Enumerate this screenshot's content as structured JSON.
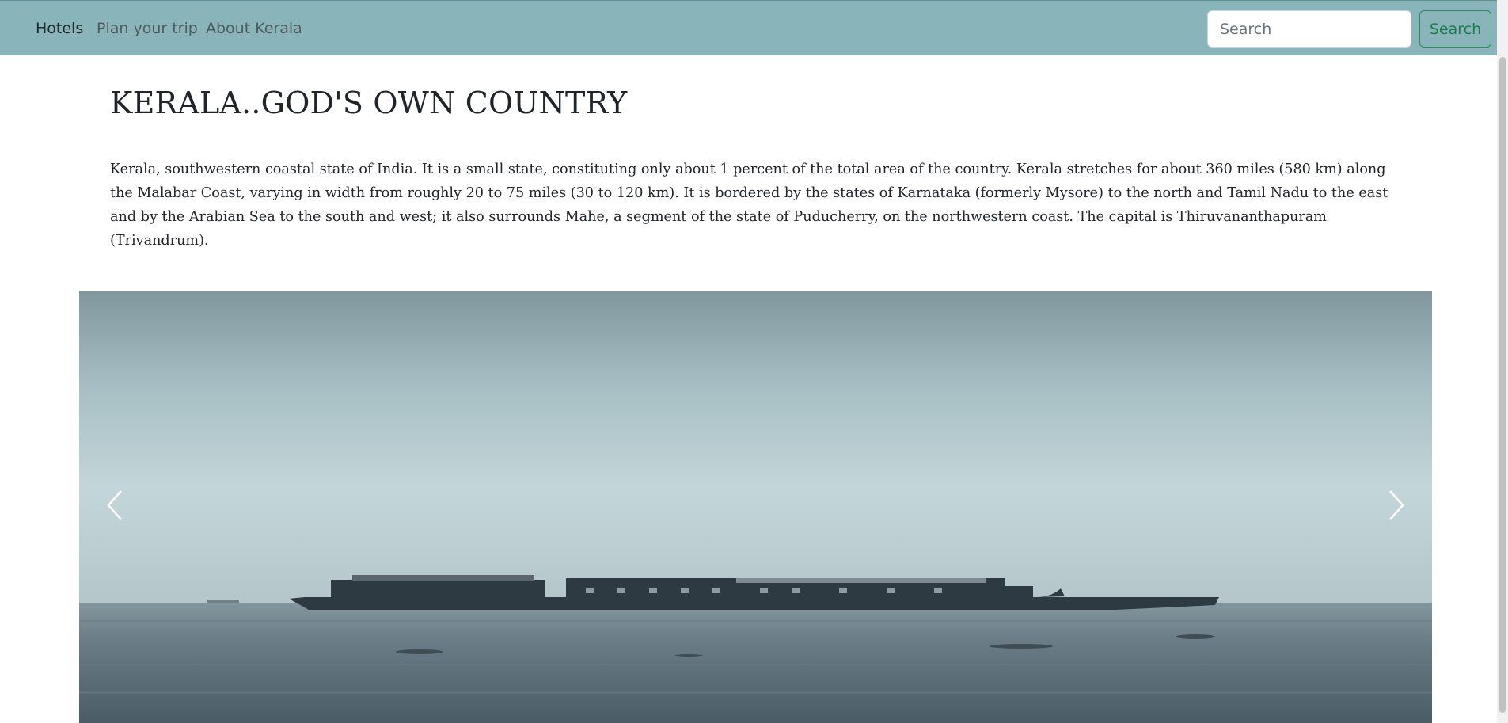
{
  "navbar": {
    "links": [
      "Hotels",
      "Plan your trip",
      "About Kerala"
    ],
    "search": {
      "placeholder": "Search",
      "button_label": "Search"
    }
  },
  "main": {
    "title": "KERALA..GOD'S OWN COUNTRY",
    "intro": "Kerala, southwestern coastal state of India. It is a small state, constituting only about 1 percent of the total area of the country. Kerala stretches for about 360 miles (580 km) along the Malabar Coast, varying in width from roughly 20 to 75 miles (30 to 120 km). It is bordered by the states of Karnataka (formerly Mysore) to the north and Tamil Nadu to the east and by the Arabian Sea to the south and west; it also surrounds Mahe, a segment of the state of Puducherry, on the northwestern coast. The capital is Thiruvananthapuram (Trivandrum)."
  },
  "carousel": {
    "controls": {
      "prev_icon": "chevron-left-icon",
      "next_icon": "chevron-right-icon"
    }
  },
  "colors": {
    "navbar_bg": "#88b4ba",
    "search_button_border": "#2e8b57",
    "sky_light": "#c3d6d9",
    "water": "#5b6e77"
  }
}
